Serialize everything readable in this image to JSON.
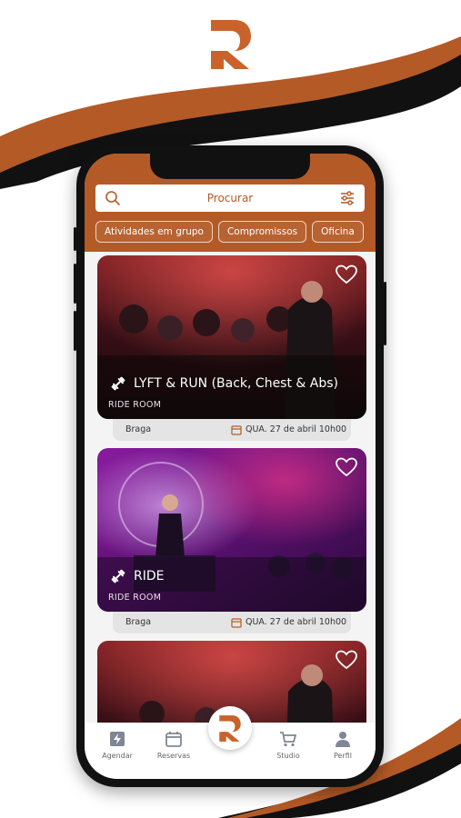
{
  "brand": {
    "color": "#b45a26",
    "dark": "#111111",
    "logo_letter": "R"
  },
  "search": {
    "placeholder": "Procurar"
  },
  "categories": [
    "Atividades em grupo",
    "Compromissos",
    "Oficina"
  ],
  "cards": [
    {
      "title": "LYFT & RUN (Back, Chest & Abs)",
      "room": "RIDE ROOM",
      "location": "Braga",
      "date": "QUA. 27 de abril 10h00"
    },
    {
      "title": "RIDE",
      "room": "RIDE ROOM",
      "location": "Braga",
      "date": "QUA. 27 de abril 10h00"
    },
    {
      "title": "",
      "room": "",
      "location": "",
      "date": ""
    }
  ],
  "nav": {
    "agendar": "Agendar",
    "reservas": "Reservas",
    "studio": "Studio",
    "perfil": "Perfil"
  }
}
